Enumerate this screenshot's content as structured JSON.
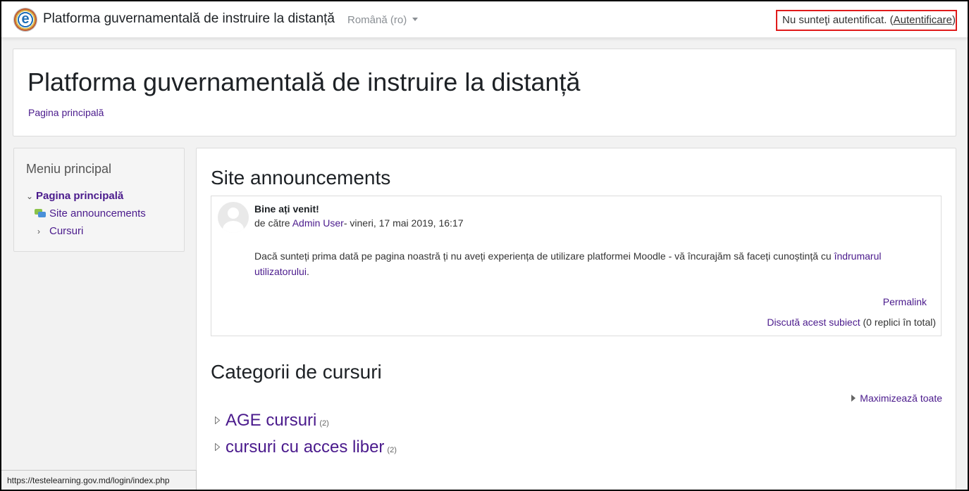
{
  "navbar": {
    "brand": "Platforma guvernamentală de instruire la distanță",
    "language": "Română (ro)",
    "login_text": "Nu sunteţi autentificat. (",
    "login_link": "Autentificare",
    "login_close": ")"
  },
  "header": {
    "title": "Platforma guvernamentală de instruire la distanță",
    "breadcrumb": "Pagina principală"
  },
  "sidebar": {
    "title": "Meniu principal",
    "items": [
      {
        "label": "Pagina principală"
      },
      {
        "label": "Site announcements"
      },
      {
        "label": "Cursuri"
      }
    ]
  },
  "announcements": {
    "title": "Site announcements",
    "post": {
      "subject": "Bine ați venit!",
      "by_prefix": "de către ",
      "author": "Admin User",
      "date": "- vineri, 17 mai 2019, 16:17",
      "body_text": "Dacă sunteți prima dată pe pagina noastră ți nu aveți experiența de utilizare platformei Moodle - vă încurajăm să faceți cunoștință cu ",
      "body_link": "îndrumarul utilizatorului",
      "body_end": ".",
      "permalink": "Permalink",
      "discuss_link": "Discută acest subiect",
      "discuss_count": " (0 replici în total)"
    }
  },
  "categories": {
    "title": "Categorii de cursuri",
    "expand_all": "Maximizează toate",
    "items": [
      {
        "name": "AGE cursuri",
        "count": "(2)"
      },
      {
        "name": "cursuri cu acces liber",
        "count": "(2)"
      }
    ]
  },
  "statusbar": {
    "url": "https://testelearning.gov.md/login/index.php"
  }
}
